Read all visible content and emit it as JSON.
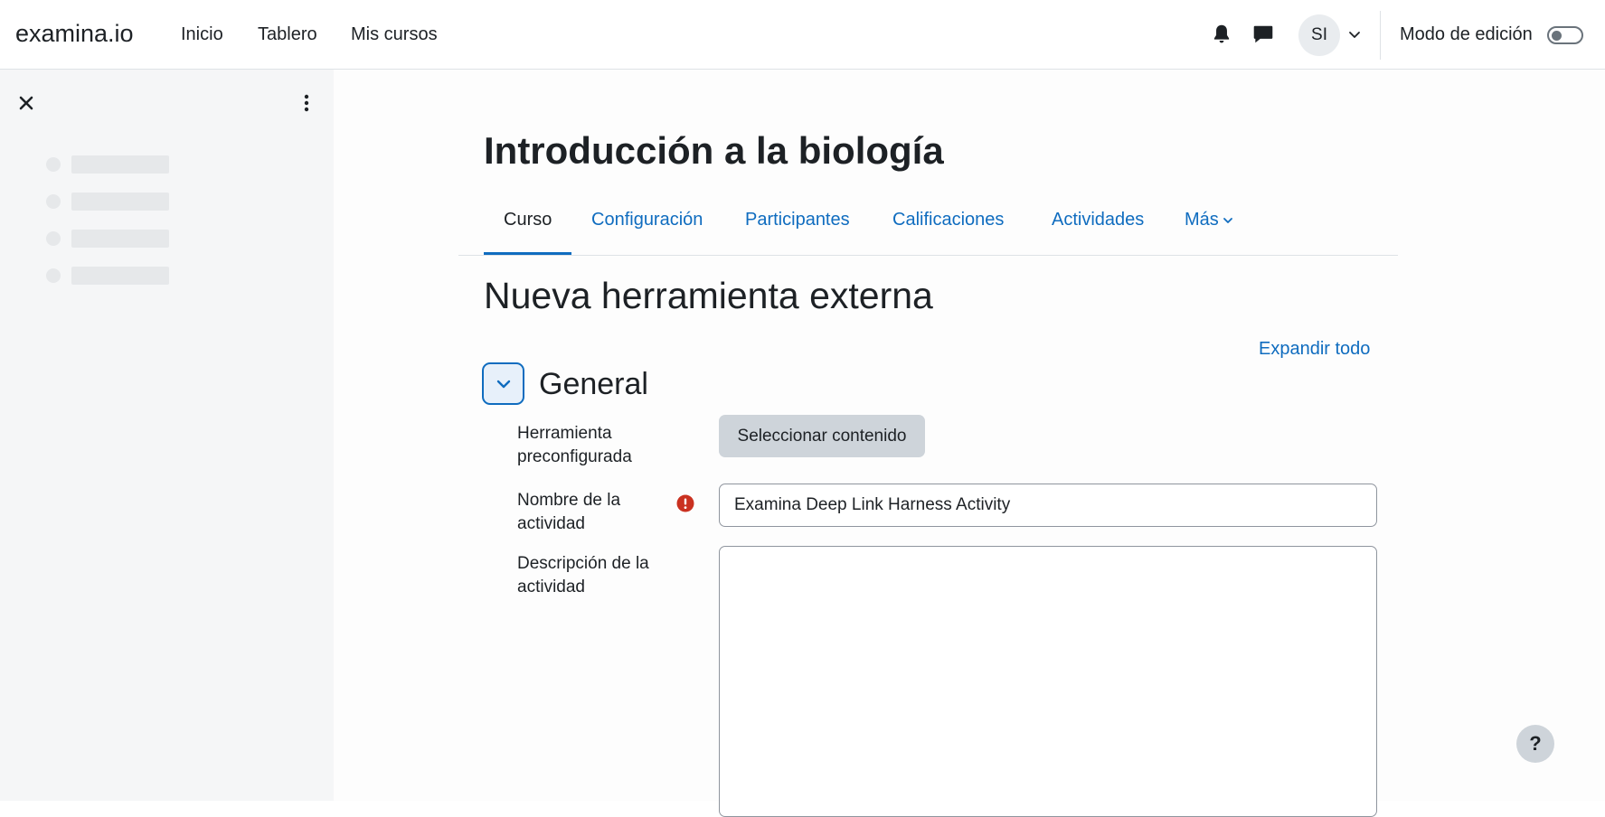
{
  "navbar": {
    "brand": "examina.io",
    "links": [
      "Inicio",
      "Tablero",
      "Mis cursos"
    ],
    "user_initials": "SI",
    "edit_mode_label": "Modo de edición",
    "edit_mode_on": false
  },
  "drawer": {
    "icons": [
      "close-icon",
      "kebab-menu-icon"
    ],
    "placeholder_rows": 4
  },
  "course": {
    "title": "Introducción a la biología",
    "tabs": [
      "Curso",
      "Configuración",
      "Participantes",
      "Calificaciones",
      "Actividades",
      "Más"
    ],
    "active_tab": "Curso"
  },
  "form": {
    "heading": "Nueva herramienta externa",
    "expand_all": "Expandir todo",
    "section_title": "General",
    "fields": {
      "preconfigured_label": "Herramienta preconfigurada",
      "select_content_button": "Seleccionar contenido",
      "activity_name_label": "Nombre de la actividad",
      "activity_name_value": "Examina Deep Link Harness Activity",
      "activity_description_label": "Descripción de la actividad",
      "activity_description_value": ""
    }
  },
  "help_button": "?",
  "colors": {
    "accent": "#0f6cbf",
    "required": "#ca3120",
    "drawer_bg": "#f5f6f7"
  }
}
